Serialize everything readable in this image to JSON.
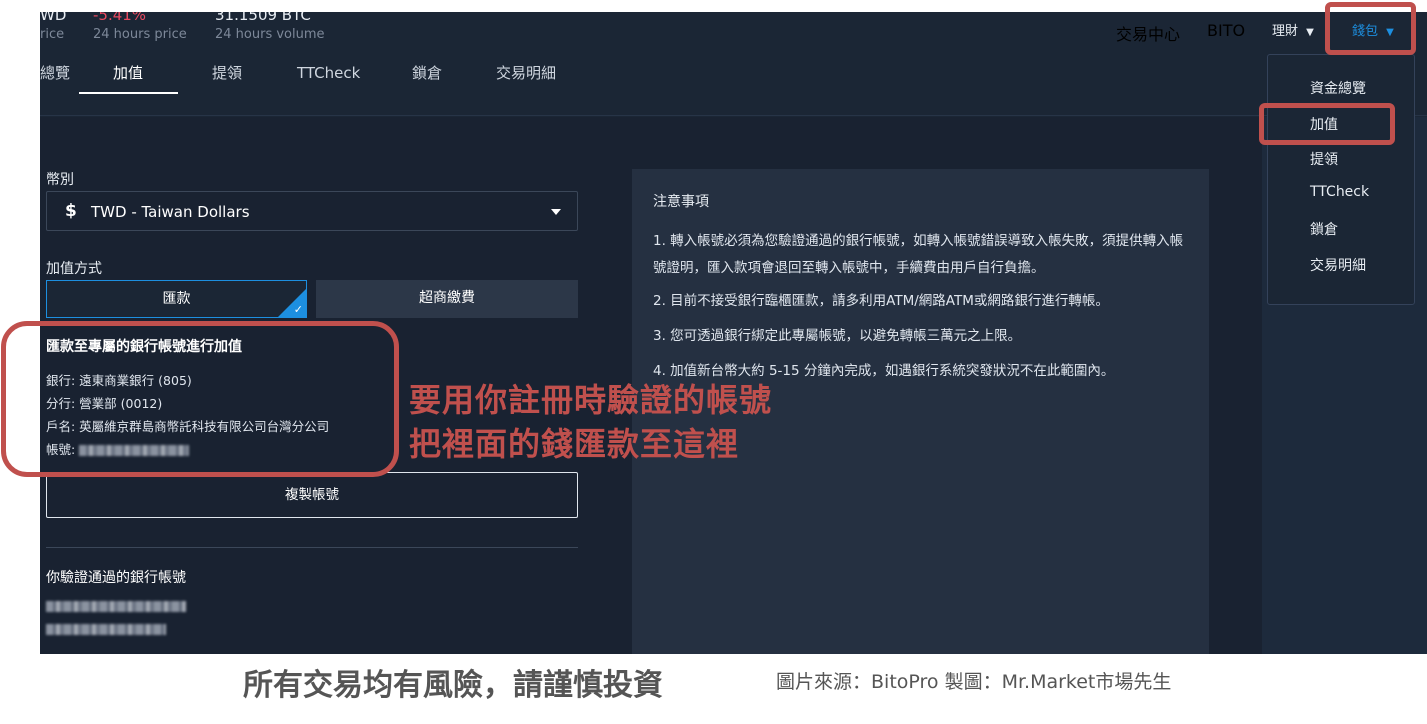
{
  "ticker": {
    "pair_fragment": "WD",
    "price_label": "rice",
    "change": "-5.41%",
    "change_label": "24 hours price",
    "volume": "31.1509 BTC",
    "volume_label": "24 hours volume"
  },
  "topnav": {
    "exchange": "交易中心",
    "bito": "BITO",
    "finance": "理財",
    "wallet": "錢包"
  },
  "tabs": [
    {
      "label": "總覽"
    },
    {
      "label": "加值"
    },
    {
      "label": "提領"
    },
    {
      "label": "TTCheck"
    },
    {
      "label": "鎖倉"
    },
    {
      "label": "交易明細"
    }
  ],
  "form": {
    "currency_label": "幣別",
    "currency_symbol": "$",
    "currency_value": "TWD - Taiwan Dollars",
    "method_label": "加值方式",
    "method_remit": "匯款",
    "method_store": "超商繳費",
    "info_title": "匯款至專屬的銀行帳號進行加值",
    "bank": "銀行: 遠東商業銀行 (805)",
    "branch": "分行: 營業部 (0012)",
    "account_name": "戶名: 英屬維京群島商幣託科技有限公司台灣分公司",
    "account_label": "帳號:",
    "copy_button": "複製帳號",
    "verified_title": "你驗證通過的銀行帳號"
  },
  "notes": {
    "title": "注意事項",
    "items": [
      "1. 轉入帳號必須為您驗證通過的銀行帳號，如轉入帳號錯誤導致入帳失敗，須提供轉入帳號證明，匯入款項會退回至轉入帳號中，手續費由用戶自行負擔。",
      "2. 目前不接受銀行臨櫃匯款，請多利用ATM/網路ATM或網路銀行進行轉帳。",
      "3. 您可透過銀行綁定此專屬帳號，以避免轉帳三萬元之上限。",
      "4. 加值新台幣大約 5-15 分鐘內完成，如遇銀行系統突發狀況不在此範圍內。"
    ]
  },
  "wallet_menu": [
    {
      "label": "資金總覽"
    },
    {
      "label": "加值"
    },
    {
      "label": "提領"
    },
    {
      "label": "TTCheck"
    },
    {
      "label": "鎖倉"
    },
    {
      "label": "交易明細"
    }
  ],
  "overlay": {
    "line1": "要用你註冊時驗證的帳號",
    "line2": "把裡面的錢匯款至這裡"
  },
  "footer": {
    "warning": "所有交易均有風險，請謹慎投資",
    "credit": "圖片來源：BitoPro  製圖：Mr.Market市場先生"
  },
  "colors": {
    "background": "#1b2635",
    "accent": "#1d8fe0",
    "annotation": "#c0504d",
    "negative": "#e84a5f"
  }
}
